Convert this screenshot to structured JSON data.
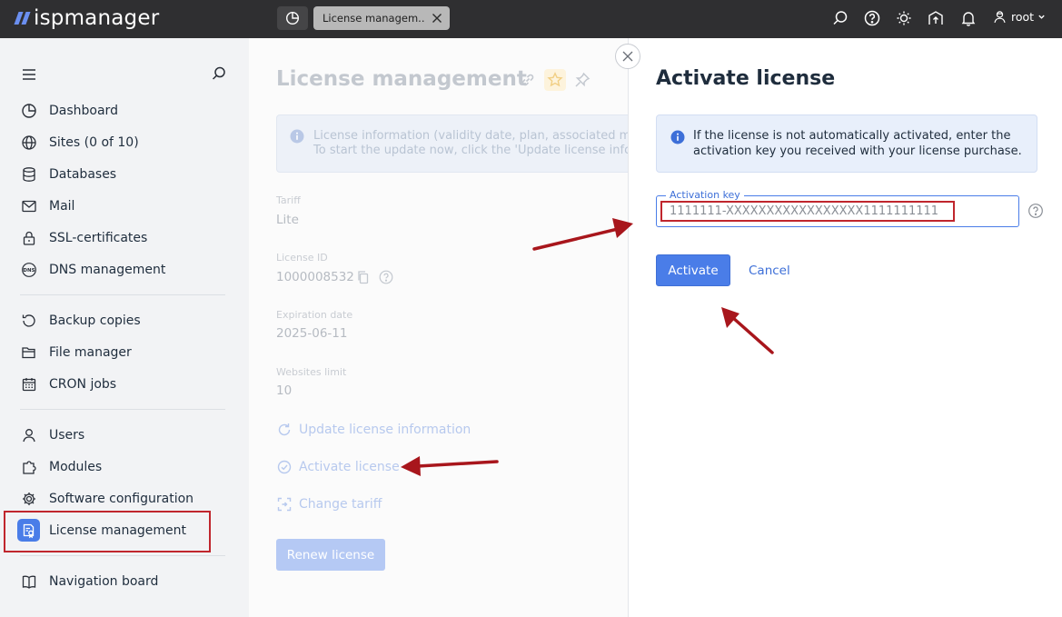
{
  "topbar": {
    "logo_text": "ispmanager",
    "active_tab_label": "License managem...",
    "user_label": "root"
  },
  "sidebar": {
    "items": [
      {
        "label": "Dashboard",
        "icon": "dashboard-icon"
      },
      {
        "label": "Sites (0 of 10)",
        "icon": "globe-icon"
      },
      {
        "label": "Databases",
        "icon": "database-icon"
      },
      {
        "label": "Mail",
        "icon": "mail-icon"
      },
      {
        "label": "SSL-certificates",
        "icon": "lock-icon"
      },
      {
        "label": "DNS management",
        "icon": "dns-icon"
      },
      {
        "label": "Backup copies",
        "icon": "backup-icon"
      },
      {
        "label": "File manager",
        "icon": "folder-icon"
      },
      {
        "label": "CRON jobs",
        "icon": "calendar-icon"
      },
      {
        "label": "Users",
        "icon": "user-icon"
      },
      {
        "label": "Modules",
        "icon": "puzzle-icon"
      },
      {
        "label": "Software configuration",
        "icon": "gear-icon"
      },
      {
        "label": "License management",
        "icon": "license-icon"
      },
      {
        "label": "Navigation board",
        "icon": "book-icon"
      }
    ],
    "dns_icon_text": "DNS"
  },
  "main": {
    "title": "License management",
    "info_line1": "License information (validity date, plan, associated modules",
    "info_line2": "To start the update now, click the 'Update license information'",
    "fields": [
      {
        "label": "Tariff",
        "value": "Lite"
      },
      {
        "label": "License ID",
        "value": "1000008532"
      },
      {
        "label": "Expiration date",
        "value": "2025-06-11"
      },
      {
        "label": "Websites limit",
        "value": "10"
      }
    ],
    "actions": {
      "update": "Update license information",
      "activate": "Activate license",
      "change": "Change tariff"
    },
    "renew_label": "Renew license"
  },
  "panel": {
    "title": "Activate license",
    "info_text": "If the license is not automatically activated, enter the activation key you received with your license purchase.",
    "key_label": "Activation key",
    "key_value": "1111111-XXXXXXXXXXXXXXXXX1111111111",
    "activate_label": "Activate",
    "cancel_label": "Cancel"
  },
  "colors": {
    "accent": "#4a7de8",
    "highlight": "#c0262d",
    "topbar": "#2f2f31"
  }
}
